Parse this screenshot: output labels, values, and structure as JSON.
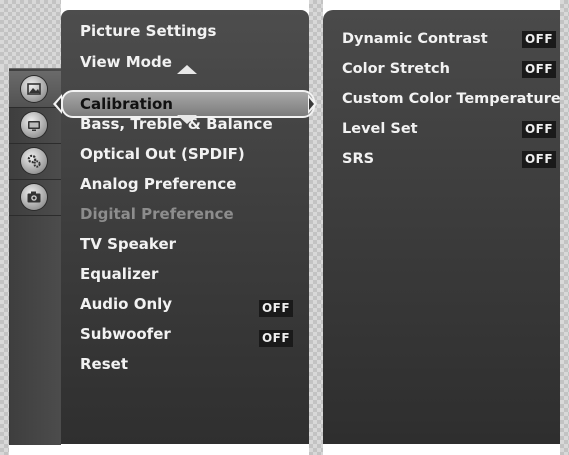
{
  "sidebar": {
    "icons": [
      {
        "name": "picture-icon"
      },
      {
        "name": "tv-icon"
      },
      {
        "name": "settings-icon"
      },
      {
        "name": "camera-icon"
      }
    ]
  },
  "main_menu": {
    "selected_label": "Calibration",
    "items": [
      {
        "label": "Picture Settings"
      },
      {
        "label": "View Mode"
      },
      {
        "label": "Calibration"
      },
      {
        "label": "Bass, Treble & Balance"
      },
      {
        "label": "Optical Out (SPDIF)"
      },
      {
        "label": "Analog Preference"
      },
      {
        "label": "Digital Preference"
      },
      {
        "label": "TV Speaker"
      },
      {
        "label": "Equalizer"
      },
      {
        "label": "Audio Only",
        "value": "OFF"
      },
      {
        "label": "Subwoofer",
        "value": "OFF"
      },
      {
        "label": "Reset"
      }
    ]
  },
  "submenu": {
    "items": [
      {
        "label": "Dynamic Contrast",
        "value": "OFF"
      },
      {
        "label": "Color Stretch",
        "value": "OFF"
      },
      {
        "label": "Custom Color Temperature"
      },
      {
        "label": "Level Set",
        "value": "OFF"
      },
      {
        "label": "SRS",
        "value": "OFF"
      }
    ]
  }
}
